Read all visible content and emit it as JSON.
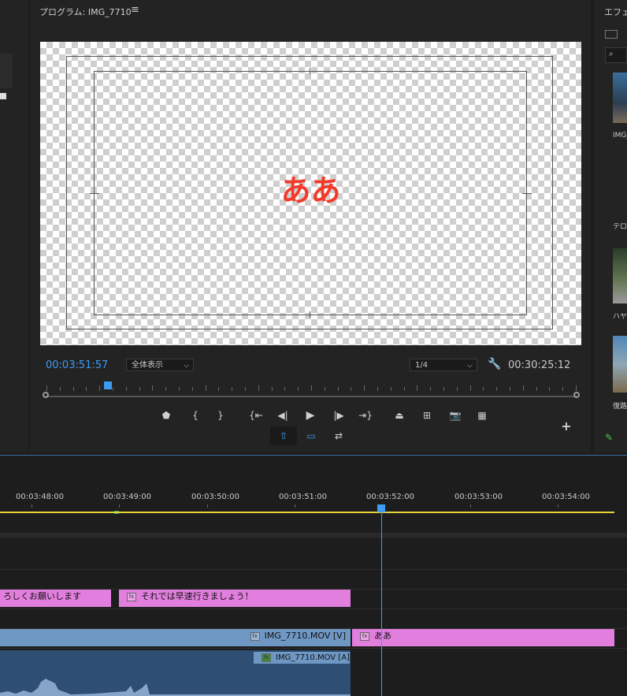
{
  "program": {
    "title": "プログラム: IMG_7710",
    "menu_icon": "≡",
    "caption_text": "ああ",
    "current_timecode": "00:03:51:57",
    "fit_dropdown": "全体表示",
    "resolution_dropdown": "1/4",
    "duration_timecode": "00:30:25:12"
  },
  "effects_panel": {
    "title": "エフェ",
    "items": [
      {
        "label": "IMG_"
      },
      {
        "label": "テロ"
      },
      {
        "label": "ハヤ"
      },
      {
        "label": "復路"
      }
    ]
  },
  "timeline": {
    "time_labels": [
      "00:03:48:00",
      "00:03:49:00",
      "00:03:50:00",
      "00:03:51:00",
      "00:03:52:00",
      "00:03:53:00",
      "00:03:54:00"
    ],
    "captions": [
      {
        "text": "ろしくお願いします"
      },
      {
        "text": "それでは早速行きましょう！"
      }
    ],
    "video_clips": [
      {
        "text": "IMG_7710.MOV [V]"
      },
      {
        "text": "ああ"
      }
    ],
    "audio_clip": {
      "text": "IMG_7710.MOV [A]"
    }
  },
  "colors": {
    "accent": "#3e9bf2",
    "caption_red": "#f23a2a",
    "clip_pink": "#e27fde",
    "clip_blue": "#6f97c4"
  }
}
